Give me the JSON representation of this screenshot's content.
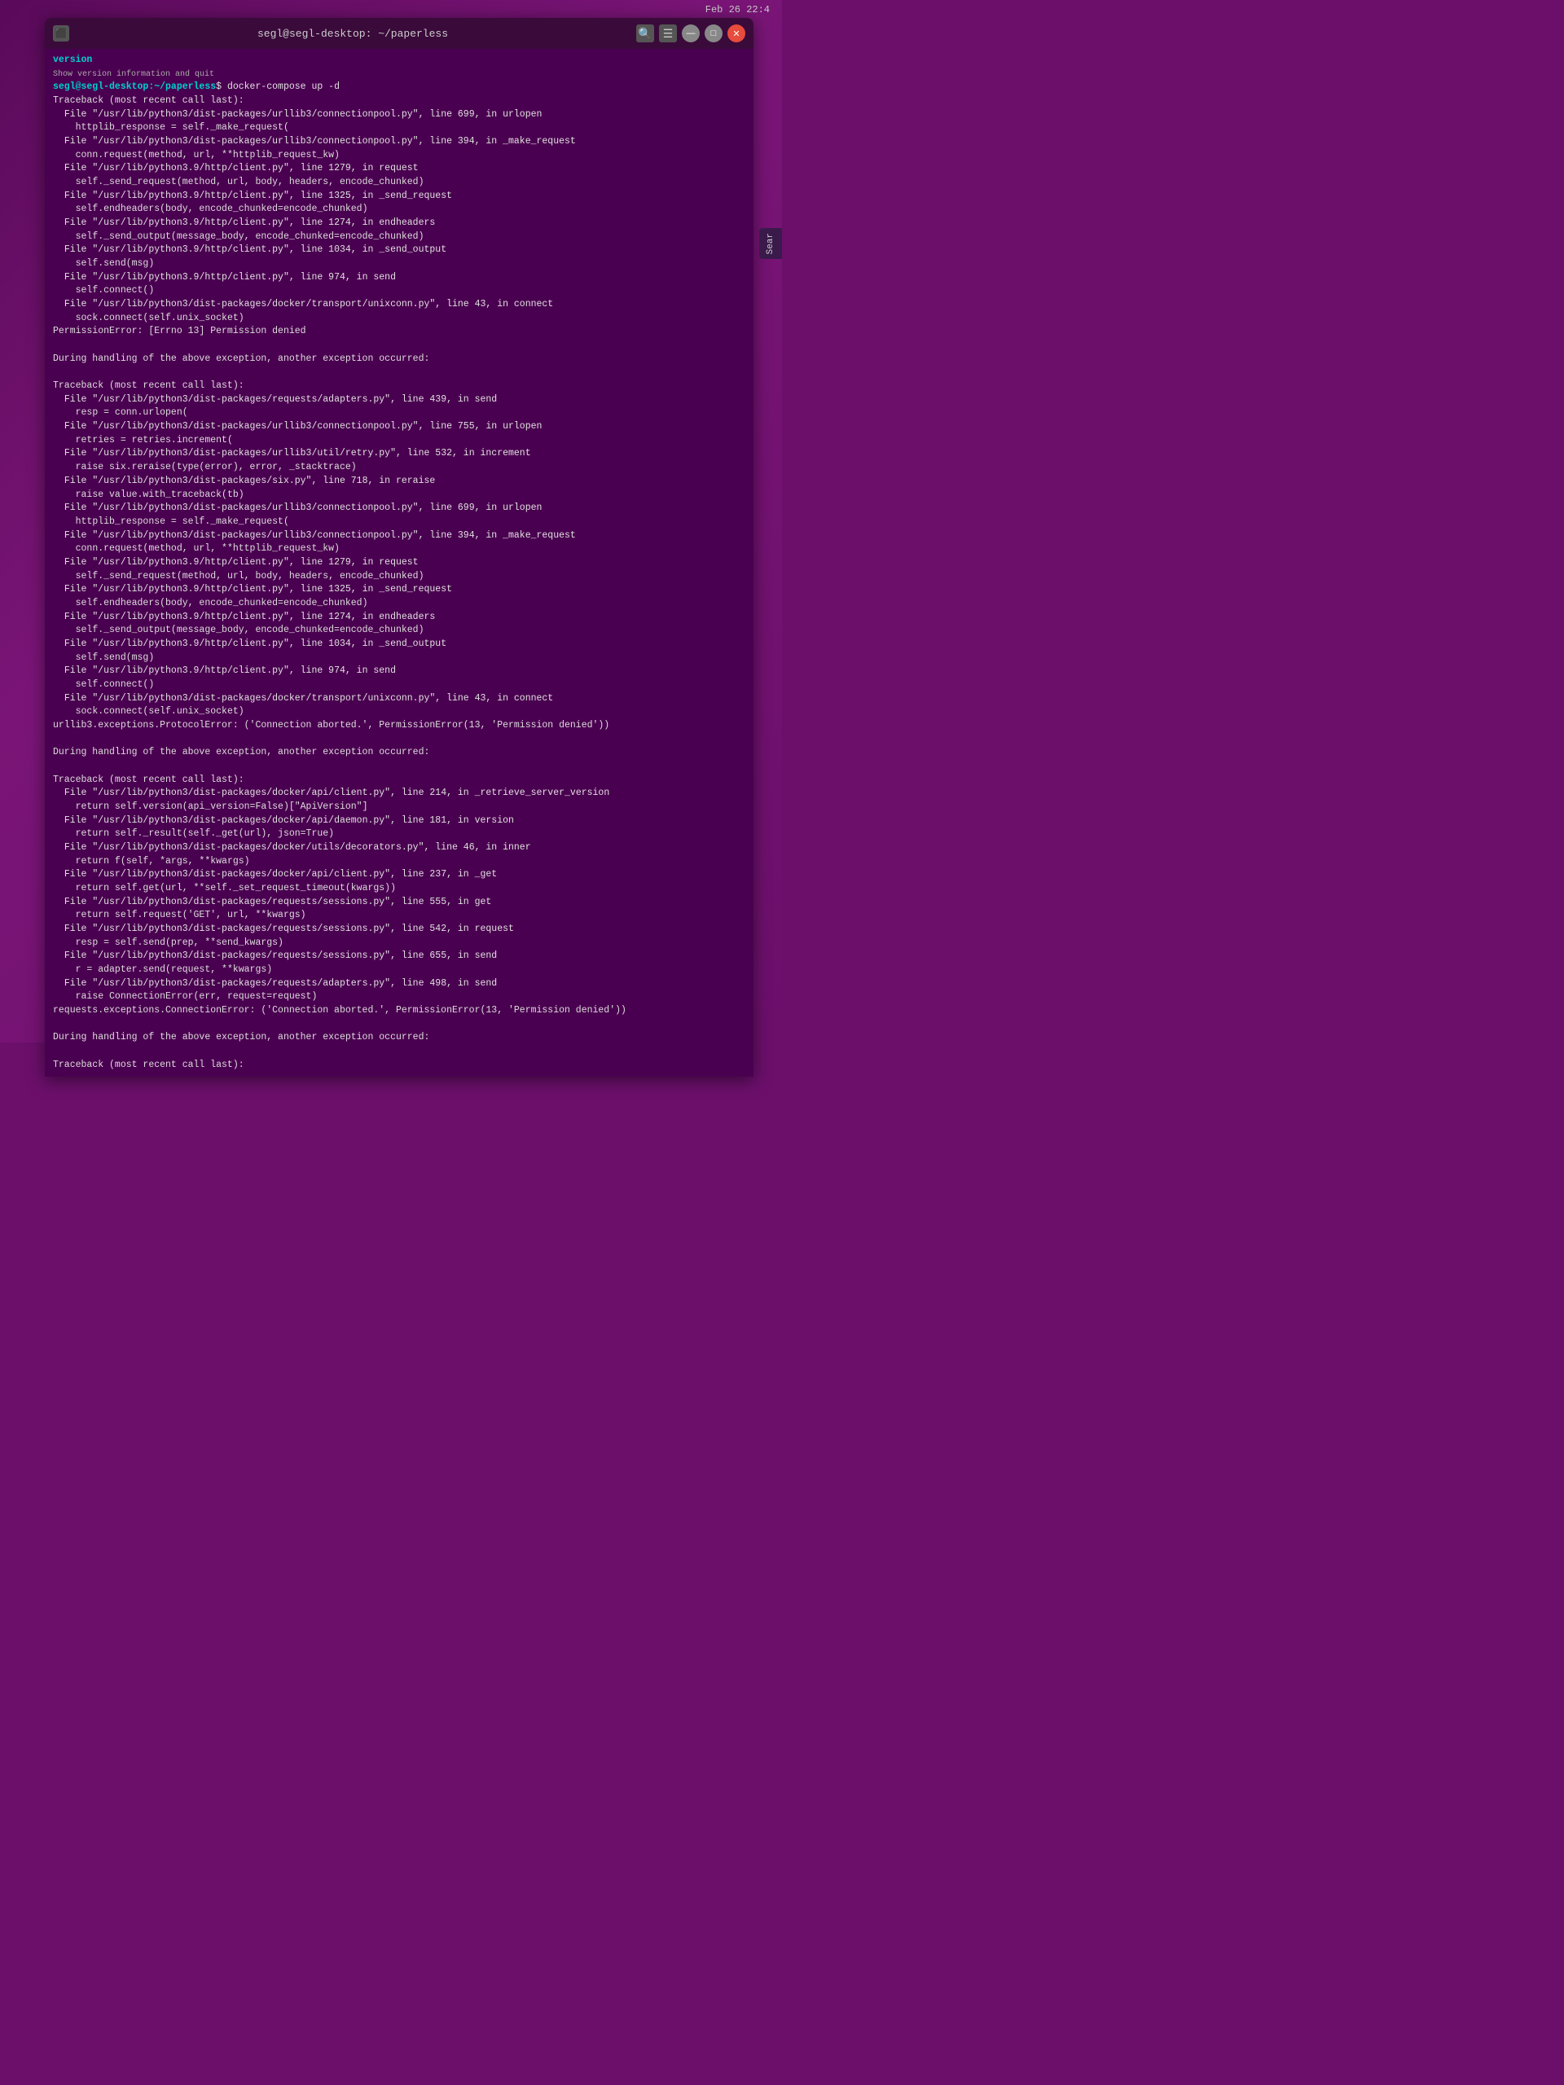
{
  "window": {
    "title": "segl@segl-desktop: ~/paperless",
    "timestamp": "Feb 26 22:4",
    "icon": "⬛"
  },
  "buttons": {
    "search": "🔍",
    "menu": "☰",
    "minimize": "—",
    "maximize": "□",
    "close": "✕"
  },
  "terminal": {
    "prompt_user": "segl@segl-desktop",
    "prompt_path": "~/paperless",
    "command": "docker-compose up -d",
    "lines": [
      {
        "type": "header",
        "text": "version",
        "indent": 0,
        "style": "cyan"
      },
      {
        "type": "text",
        "text": "segl@segl-desktop:~/paperless$ docker-compose up -d",
        "indent": 0,
        "style": "cyan-white"
      },
      {
        "type": "text",
        "text": "Traceback (most recent call last):",
        "indent": 0,
        "style": "white"
      },
      {
        "type": "text",
        "text": "  File \"/usr/lib/python3/dist-packages/urllib3/connectionpool.py\", line 699, in urlopen",
        "indent": 1,
        "style": "white"
      },
      {
        "type": "text",
        "text": "    httplib_response = self._make_request(",
        "indent": 2,
        "style": "white"
      },
      {
        "type": "text",
        "text": "  File \"/usr/lib/python3/dist-packages/urllib3/connectionpool.py\", line 394, in _make_request",
        "indent": 1,
        "style": "white"
      },
      {
        "type": "text",
        "text": "    conn.request(method, url, **httplib_request_kw)",
        "indent": 2,
        "style": "white"
      },
      {
        "type": "text",
        "text": "  File \"/usr/lib/python3.9/http/client.py\", line 1279, in request",
        "indent": 1,
        "style": "white"
      },
      {
        "type": "text",
        "text": "    self._send_request(method, url, body, headers, encode_chunked)",
        "indent": 2,
        "style": "white"
      },
      {
        "type": "text",
        "text": "  File \"/usr/lib/python3.9/http/client.py\", line 1325, in _send_request",
        "indent": 1,
        "style": "white"
      },
      {
        "type": "text",
        "text": "    self.endheaders(body, encode_chunked=encode_chunked)",
        "indent": 2,
        "style": "white"
      },
      {
        "type": "text",
        "text": "  File \"/usr/lib/python3.9/http/client.py\", line 1274, in endheaders",
        "indent": 1,
        "style": "white"
      },
      {
        "type": "text",
        "text": "    self._send_output(message_body, encode_chunked=encode_chunked)",
        "indent": 2,
        "style": "white"
      },
      {
        "type": "text",
        "text": "  File \"/usr/lib/python3.9/http/client.py\", line 1034, in _send_output",
        "indent": 1,
        "style": "white"
      },
      {
        "type": "text",
        "text": "    self.send(msg)",
        "indent": 2,
        "style": "white"
      },
      {
        "type": "text",
        "text": "  File \"/usr/lib/python3.9/http/client.py\", line 974, in send",
        "indent": 1,
        "style": "white"
      },
      {
        "type": "text",
        "text": "    self.connect()",
        "indent": 2,
        "style": "white"
      },
      {
        "type": "text",
        "text": "  File \"/usr/lib/python3/dist-packages/docker/transport/unixconn.py\", line 43, in connect",
        "indent": 1,
        "style": "white"
      },
      {
        "type": "text",
        "text": "    sock.connect(self.unix_socket)",
        "indent": 2,
        "style": "white"
      },
      {
        "type": "text",
        "text": "PermissionError: [Errno 13] Permission denied",
        "indent": 0,
        "style": "white"
      },
      {
        "type": "blank",
        "text": "",
        "indent": 0,
        "style": "white"
      },
      {
        "type": "text",
        "text": "During handling of the above exception, another exception occurred:",
        "indent": 0,
        "style": "white"
      },
      {
        "type": "blank",
        "text": "",
        "indent": 0,
        "style": "white"
      },
      {
        "type": "text",
        "text": "Traceback (most recent call last):",
        "indent": 0,
        "style": "white"
      },
      {
        "type": "text",
        "text": "  File \"/usr/lib/python3/dist-packages/requests/adapters.py\", line 439, in send",
        "indent": 1,
        "style": "white"
      },
      {
        "type": "text",
        "text": "    resp = conn.urlopen(",
        "indent": 2,
        "style": "white"
      },
      {
        "type": "text",
        "text": "  File \"/usr/lib/python3/dist-packages/urllib3/connectionpool.py\", line 755, in urlopen",
        "indent": 1,
        "style": "white"
      },
      {
        "type": "text",
        "text": "    retries = retries.increment(",
        "indent": 2,
        "style": "white"
      },
      {
        "type": "text",
        "text": "  File \"/usr/lib/python3/dist-packages/urllib3/util/retry.py\", line 532, in increment",
        "indent": 1,
        "style": "white"
      },
      {
        "type": "text",
        "text": "    raise six.reraise(type(error), error, _stacktrace)",
        "indent": 2,
        "style": "white"
      },
      {
        "type": "text",
        "text": "  File \"/usr/lib/python3/dist-packages/six.py\", line 718, in reraise",
        "indent": 1,
        "style": "white"
      },
      {
        "type": "text",
        "text": "    raise value.with_traceback(tb)",
        "indent": 2,
        "style": "white"
      },
      {
        "type": "text",
        "text": "  File \"/usr/lib/python3/dist-packages/urllib3/connectionpool.py\", line 699, in urlopen",
        "indent": 1,
        "style": "white"
      },
      {
        "type": "text",
        "text": "    httplib_response = self._make_request(",
        "indent": 2,
        "style": "white"
      },
      {
        "type": "text",
        "text": "  File \"/usr/lib/python3/dist-packages/urllib3/connectionpool.py\", line 394, in _make_request",
        "indent": 1,
        "style": "white"
      },
      {
        "type": "text",
        "text": "    conn.request(method, url, **httplib_request_kw)",
        "indent": 2,
        "style": "white"
      },
      {
        "type": "text",
        "text": "  File \"/usr/lib/python3.9/http/client.py\", line 1279, in request",
        "indent": 1,
        "style": "white"
      },
      {
        "type": "text",
        "text": "    self._send_request(method, url, body, headers, encode_chunked)",
        "indent": 2,
        "style": "white"
      },
      {
        "type": "text",
        "text": "  File \"/usr/lib/python3.9/http/client.py\", line 1325, in _send_request",
        "indent": 1,
        "style": "white"
      },
      {
        "type": "text",
        "text": "    self.endheaders(body, encode_chunked=encode_chunked)",
        "indent": 2,
        "style": "white"
      },
      {
        "type": "text",
        "text": "  File \"/usr/lib/python3.9/http/client.py\", line 1274, in endheaders",
        "indent": 1,
        "style": "white"
      },
      {
        "type": "text",
        "text": "    self._send_output(message_body, encode_chunked=encode_chunked)",
        "indent": 2,
        "style": "white"
      },
      {
        "type": "text",
        "text": "  File \"/usr/lib/python3.9/http/client.py\", line 1034, in _send_output",
        "indent": 1,
        "style": "white"
      },
      {
        "type": "text",
        "text": "    self.send(msg)",
        "indent": 2,
        "style": "white"
      },
      {
        "type": "text",
        "text": "  File \"/usr/lib/python3.9/http/client.py\", line 974, in send",
        "indent": 1,
        "style": "white"
      },
      {
        "type": "text",
        "text": "    self.connect()",
        "indent": 2,
        "style": "white"
      },
      {
        "type": "text",
        "text": "  File \"/usr/lib/python3/dist-packages/docker/transport/unixconn.py\", line 43, in connect",
        "indent": 1,
        "style": "white"
      },
      {
        "type": "text",
        "text": "    sock.connect(self.unix_socket)",
        "indent": 2,
        "style": "white"
      },
      {
        "type": "text",
        "text": "urllib3.exceptions.ProtocolError: ('Connection aborted.', PermissionError(13, 'Permission denied'))",
        "indent": 0,
        "style": "white"
      },
      {
        "type": "blank",
        "text": "",
        "indent": 0,
        "style": "white"
      },
      {
        "type": "text",
        "text": "During handling of the above exception, another exception occurred:",
        "indent": 0,
        "style": "white"
      },
      {
        "type": "blank",
        "text": "",
        "indent": 0,
        "style": "white"
      },
      {
        "type": "text",
        "text": "Traceback (most recent call last):",
        "indent": 0,
        "style": "white"
      },
      {
        "type": "text",
        "text": "  File \"/usr/lib/python3/dist-packages/docker/api/client.py\", line 214, in _retrieve_server_version",
        "indent": 1,
        "style": "white"
      },
      {
        "type": "text",
        "text": "    return self.version(api_version=False)[\"ApiVersion\"]",
        "indent": 2,
        "style": "white"
      },
      {
        "type": "text",
        "text": "  File \"/usr/lib/python3/dist-packages/docker/api/daemon.py\", line 181, in version",
        "indent": 1,
        "style": "white"
      },
      {
        "type": "text",
        "text": "    return self._result(self._get(url), json=True)",
        "indent": 2,
        "style": "white"
      },
      {
        "type": "text",
        "text": "  File \"/usr/lib/python3/dist-packages/docker/utils/decorators.py\", line 46, in inner",
        "indent": 1,
        "style": "white"
      },
      {
        "type": "text",
        "text": "    return f(self, *args, **kwargs)",
        "indent": 2,
        "style": "white"
      },
      {
        "type": "text",
        "text": "  File \"/usr/lib/python3/dist-packages/docker/api/client.py\", line 237, in _get",
        "indent": 1,
        "style": "white"
      },
      {
        "type": "text",
        "text": "    return self.get(url, **self._set_request_timeout(kwargs))",
        "indent": 2,
        "style": "white"
      },
      {
        "type": "text",
        "text": "  File \"/usr/lib/python3/dist-packages/requests/sessions.py\", line 555, in get",
        "indent": 1,
        "style": "white"
      },
      {
        "type": "text",
        "text": "    return self.request('GET', url, **kwargs)",
        "indent": 2,
        "style": "white"
      },
      {
        "type": "text",
        "text": "  File \"/usr/lib/python3/dist-packages/requests/sessions.py\", line 542, in request",
        "indent": 1,
        "style": "white"
      },
      {
        "type": "text",
        "text": "    resp = self.send(prep, **send_kwargs)",
        "indent": 2,
        "style": "white"
      },
      {
        "type": "text",
        "text": "  File \"/usr/lib/python3/dist-packages/requests/sessions.py\", line 655, in send",
        "indent": 1,
        "style": "white"
      },
      {
        "type": "text",
        "text": "    r = adapter.send(request, **kwargs)",
        "indent": 2,
        "style": "white"
      },
      {
        "type": "text",
        "text": "  File \"/usr/lib/python3/dist-packages/requests/adapters.py\", line 498, in send",
        "indent": 1,
        "style": "white"
      },
      {
        "type": "text",
        "text": "    raise ConnectionError(err, request=request)",
        "indent": 2,
        "style": "white"
      },
      {
        "type": "text",
        "text": "requests.exceptions.ConnectionError: ('Connection aborted.', PermissionError(13, 'Permission denied'))",
        "indent": 0,
        "style": "white"
      },
      {
        "type": "blank",
        "text": "",
        "indent": 0,
        "style": "white"
      },
      {
        "type": "text",
        "text": "During handling of the above exception, another exception occurred:",
        "indent": 0,
        "style": "white"
      },
      {
        "type": "blank",
        "text": "",
        "indent": 0,
        "style": "white"
      },
      {
        "type": "text",
        "text": "Traceback (most recent call last):",
        "indent": 0,
        "style": "white"
      }
    ]
  },
  "sidebar": {
    "search_label": "Sear"
  }
}
